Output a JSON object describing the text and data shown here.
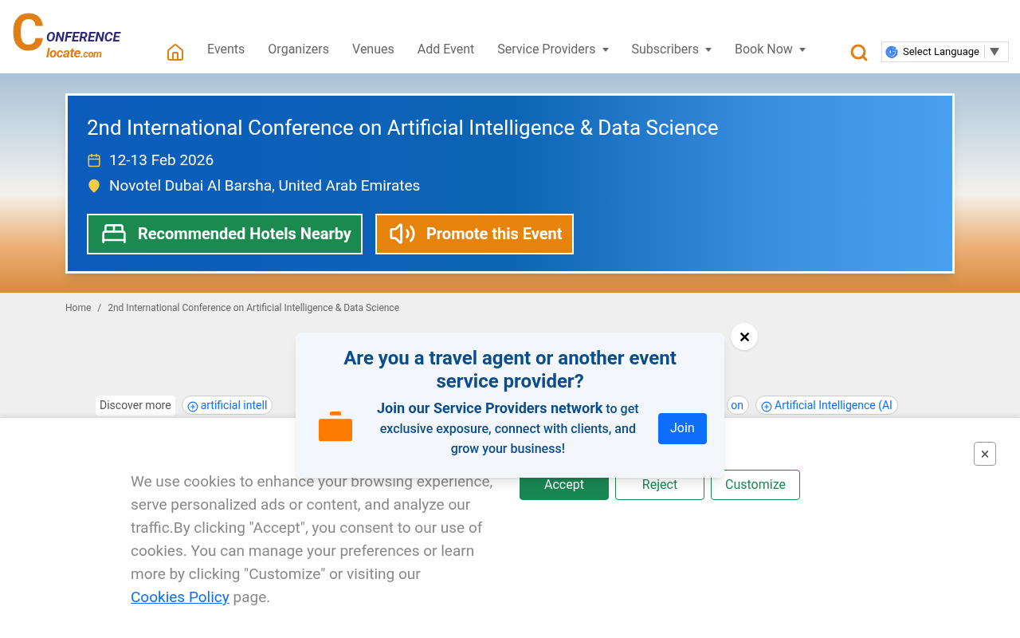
{
  "logo": {
    "big_letter": "C",
    "line1": "ONFERENCE",
    "line2": "locate",
    "suffix": ".com"
  },
  "nav": [
    {
      "label": "Events",
      "dropdown": false
    },
    {
      "label": "Organizers",
      "dropdown": false
    },
    {
      "label": "Venues",
      "dropdown": false
    },
    {
      "label": "Add Event",
      "dropdown": false
    },
    {
      "label": "Service Providers",
      "dropdown": true
    },
    {
      "label": "Subscribers",
      "dropdown": true
    },
    {
      "label": "Book Now",
      "dropdown": true
    }
  ],
  "language": {
    "label": "Select Language"
  },
  "event": {
    "title": "2nd International Conference on Artificial Intelligence & Data Science",
    "date": "12-13 Feb 2026",
    "venue": "Novotel Dubai Al Barsha, United Arab Emirates",
    "buttons": [
      {
        "label": "Recommended Hotels Nearby",
        "kind": "hotels"
      },
      {
        "label": "Promote this Event",
        "kind": "promote"
      }
    ]
  },
  "breadcrumb": {
    "separator": "/",
    "items": [
      "Home",
      "2nd International Conference on Artificial Intelligence & Data Science"
    ]
  },
  "discover": {
    "label": "Discover more",
    "tags": [
      "artificial intell",
      "on",
      "Artificial Intelligence (AI"
    ]
  },
  "popup": {
    "title": "Are you a travel agent or another event service provider?",
    "text": "**Join our Service Providers network** to get exclusive exposure, connect with clients, and grow your business!",
    "button": "Join",
    "close": "✕"
  },
  "cookies": {
    "text": "We use cookies to enhance your browsing experience, serve personalized ads or content, and analyze our traffic.By clicking \"Accept\", you consent to our use of cookies. You can manage your preferences or learn more by clicking \"Customize\" or visiting our",
    "link": "Cookies Policy",
    "after": "page.",
    "buttons": [
      {
        "label": "Accept",
        "kind": "primary"
      },
      {
        "label": "Reject",
        "kind": "outline"
      },
      {
        "label": "Customize",
        "kind": "outline"
      }
    ],
    "close": "×"
  }
}
